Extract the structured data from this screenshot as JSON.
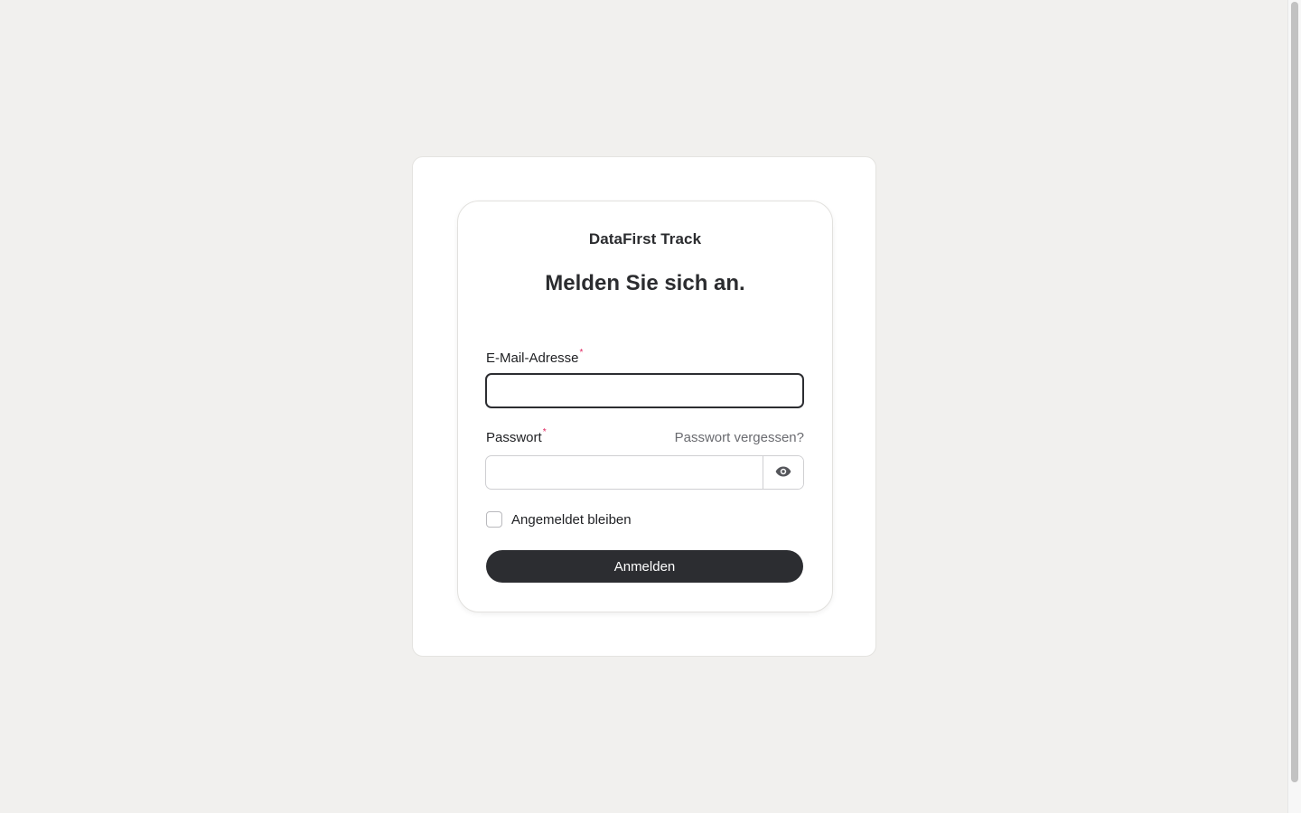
{
  "app": {
    "brand": "DataFirst Track"
  },
  "login": {
    "heading": "Melden Sie sich an.",
    "email_label": "E-Mail-Adresse",
    "email_value": "",
    "password_label": "Passwort",
    "password_value": "",
    "required_mark": "*",
    "forgot_password": "Passwort vergessen?",
    "remember_me": "Angemeldet bleiben",
    "remember_checked": false,
    "submit_label": "Anmelden"
  },
  "icons": {
    "reveal_password": "eye-icon"
  },
  "colors": {
    "page_background": "#f1f0ee",
    "primary": "#2c2d31",
    "required": "#e0245e",
    "link": "#6a6b70"
  }
}
